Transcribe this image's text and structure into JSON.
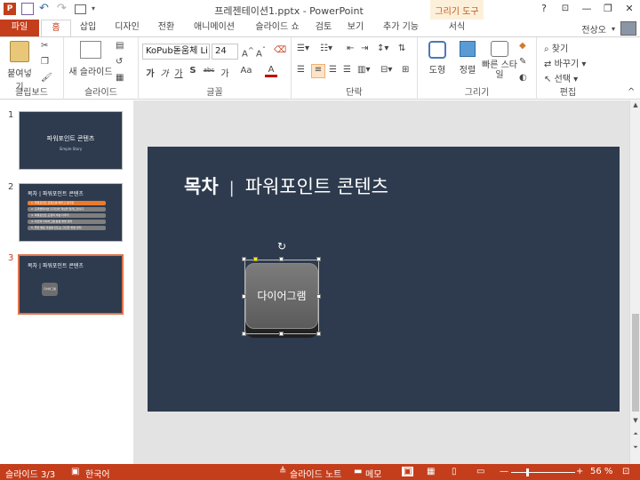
{
  "window": {
    "title": "프레젠테이션1.pptx - PowerPoint",
    "context_tab_group": "그리기 도구",
    "controls": [
      "?",
      "—",
      "❐",
      "✕"
    ]
  },
  "tabs": [
    "파일",
    "홈",
    "삽입",
    "디자인",
    "전환",
    "애니메이션",
    "슬라이드 쇼",
    "검토",
    "보기",
    "추가 기능",
    "서식"
  ],
  "active_tab": "홈",
  "user": {
    "name": "전상오"
  },
  "ribbon": {
    "clipboard": {
      "label": "클립보드",
      "paste": "붙여넣기"
    },
    "slides": {
      "label": "슬라이드",
      "new_slide": "새 슬라이드"
    },
    "font": {
      "label": "글꼴",
      "family": "KoPub돋움체 Li",
      "size": "24",
      "buttons": [
        "가",
        "가",
        "가",
        "S",
        "abc",
        "가",
        "Aa",
        "A"
      ]
    },
    "paragraph": {
      "label": "단락"
    },
    "drawing": {
      "label": "그리기",
      "shape": "도형",
      "arrange": "정렬",
      "quick_style": "빠른 스타일"
    },
    "editing": {
      "label": "편집",
      "find": "찾기",
      "replace": "바꾸기",
      "select": "선택"
    }
  },
  "slides_panel": [
    {
      "number": "1",
      "title": "파워포인트 콘텐츠",
      "subtitle": "Simple Story"
    },
    {
      "number": "2",
      "title": "목차 | 파워포인트 콘텐츠",
      "items": [
        "1. 파워포인트 콘텐츠를 배우고 싶다면",
        "2. 프레젠테이션 디자인의 핵심을 알려드립니다",
        "3. 파워포인트 도형과 색상 다루기",
        "4. 차트와 다이어그램 활용 방법 정리",
        "5. 좋은 발표 자료를 만드는 간단한 방법 정리"
      ]
    },
    {
      "number": "3",
      "title": "목차 | 파워포인트 콘텐츠",
      "shape_label": "다이어그램"
    }
  ],
  "current_slide": {
    "title_bold": "목차",
    "separator": "|",
    "title_rest": "파워포인트 콘텐츠",
    "shape_text": "다이어그램"
  },
  "status": {
    "slide_counter": "슬라이드 3/3",
    "language": "한국어",
    "notes": "슬라이드 노트",
    "comments": "메모",
    "zoom": "56 %",
    "zoom_fraction": 0.25
  },
  "colors": {
    "accent": "#c43e1c",
    "slide_bg": "#2e3b4e",
    "orange_bar": "#e97b2e"
  }
}
